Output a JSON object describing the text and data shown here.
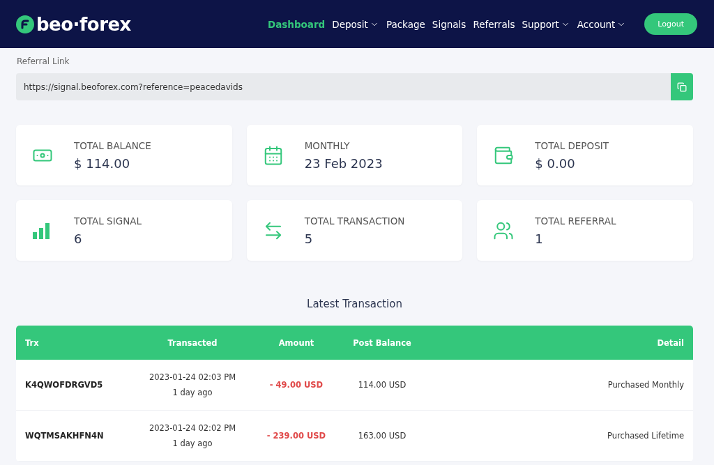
{
  "brand": {
    "name": "beo·forex"
  },
  "nav": [
    {
      "label": "Dashboard",
      "selected": true,
      "dropdown": false
    },
    {
      "label": "Deposit",
      "selected": false,
      "dropdown": true
    },
    {
      "label": "Package",
      "selected": false,
      "dropdown": false
    },
    {
      "label": "Signals",
      "selected": false,
      "dropdown": false
    },
    {
      "label": "Referrals",
      "selected": false,
      "dropdown": false
    },
    {
      "label": "Support",
      "selected": false,
      "dropdown": true
    },
    {
      "label": "Account",
      "selected": false,
      "dropdown": true
    }
  ],
  "logout": "Logout",
  "referral": {
    "label": "Referral Link",
    "value": "https://signal.beoforex.com?reference=peacedavids"
  },
  "stats": [
    {
      "kind": "money",
      "label": "TOTAL BALANCE",
      "value": "$ 114.00"
    },
    {
      "kind": "calendar",
      "label": "MONTHLY",
      "value": "23 Feb 2023"
    },
    {
      "kind": "wallet",
      "label": "TOTAL DEPOSIT",
      "value": "$ 0.00"
    },
    {
      "kind": "bars",
      "label": "TOTAL SIGNAL",
      "value": "6"
    },
    {
      "kind": "exchange",
      "label": "TOTAL TRANSACTION",
      "value": "5"
    },
    {
      "kind": "people",
      "label": "TOTAL REFERRAL",
      "value": "1"
    }
  ],
  "transactions": {
    "title": "Latest Transaction",
    "columns": [
      "Trx",
      "Transacted",
      "Amount",
      "Post Balance",
      "Detail"
    ],
    "rows": [
      {
        "trx": "K4QWOFDRGVD5",
        "date": "2023-01-24 02:03 PM",
        "ago": "1 day ago",
        "amount": "- 49.00 USD",
        "kind": "debit",
        "balance": "114.00 USD",
        "detail": "Purchased Monthly"
      },
      {
        "trx": "WQTMSAKHFN4N",
        "date": "2023-01-24 02:02 PM",
        "ago": "1 day ago",
        "amount": "- 239.00 USD",
        "kind": "debit",
        "balance": "163.00 USD",
        "detail": "Purchased Lifetime"
      }
    ]
  }
}
